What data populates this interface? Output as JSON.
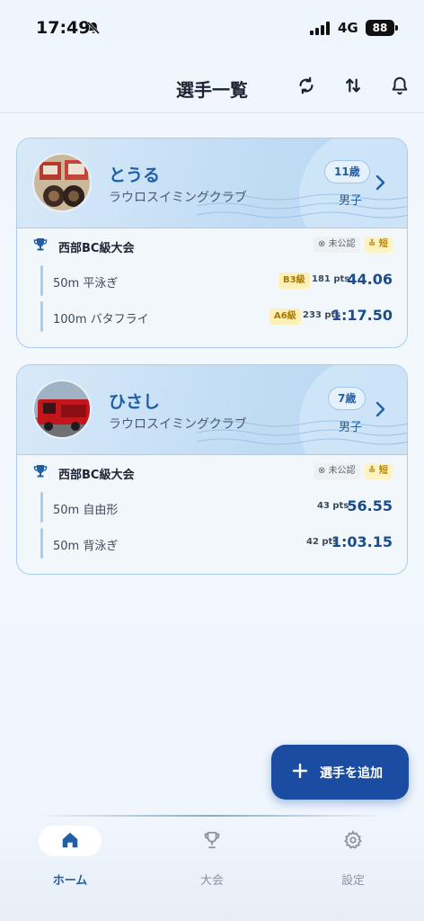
{
  "status_bar": {
    "time": "17:49",
    "network": "4G",
    "battery": "88"
  },
  "header": {
    "title": "選手一覧"
  },
  "swimmers": [
    {
      "name": "とうる",
      "club": "ラウロスイミングクラブ",
      "age": "11歳",
      "gender": "男子",
      "meet": {
        "name": "西部BC級大会",
        "official_status": "未公認",
        "course": "短",
        "events": [
          {
            "event": "50m 平泳ぎ",
            "grade": "B3級",
            "points": "181 pts",
            "time": "44.06"
          },
          {
            "event": "100m バタフライ",
            "grade": "A6級",
            "points": "233 pts",
            "time": "1:17.50"
          }
        ]
      }
    },
    {
      "name": "ひさし",
      "club": "ラウロスイミングクラブ",
      "age": "7歳",
      "gender": "男子",
      "meet": {
        "name": "西部BC級大会",
        "official_status": "未公認",
        "course": "短",
        "events": [
          {
            "event": "50m 自由形",
            "grade": "",
            "points": "43 pts",
            "time": "56.55"
          },
          {
            "event": "50m 背泳ぎ",
            "grade": "",
            "points": "42 pts",
            "time": "1:03.15"
          }
        ]
      }
    }
  ],
  "fab": {
    "label": "選手を追加"
  },
  "bottom_nav": [
    {
      "label": "ホーム",
      "icon": "home-icon",
      "active": true
    },
    {
      "label": "大会",
      "icon": "trophy-icon",
      "active": false
    },
    {
      "label": "設定",
      "icon": "gear-icon",
      "active": false
    }
  ],
  "colors": {
    "accent": "#1a4da1",
    "card_border": "#a9cdf0",
    "badge_yellow": "#fff0b8"
  }
}
